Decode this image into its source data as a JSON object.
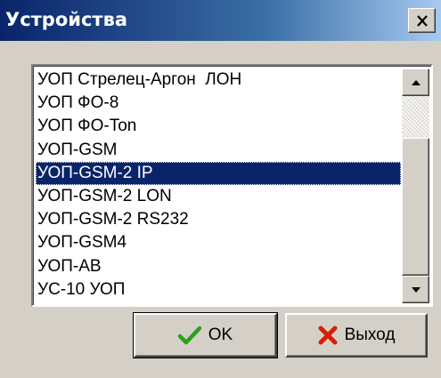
{
  "window": {
    "title": "Устройства",
    "close_symbol": "×"
  },
  "list": {
    "items": [
      {
        "label": "УОП Стрелец-Аргон  ЛОН",
        "selected": false
      },
      {
        "label": "УОП ФО-8",
        "selected": false
      },
      {
        "label": "УОП ФО-Ton",
        "selected": false
      },
      {
        "label": "УОП-GSM",
        "selected": false
      },
      {
        "label": "УОП-GSM-2 IP",
        "selected": true
      },
      {
        "label": "УОП-GSM-2 LON",
        "selected": false
      },
      {
        "label": "УОП-GSM-2 RS232",
        "selected": false
      },
      {
        "label": "УОП-GSM4",
        "selected": false
      },
      {
        "label": "УОП-АВ",
        "selected": false
      },
      {
        "label": "УС-10 УОП",
        "selected": false
      }
    ]
  },
  "buttons": {
    "ok_label": "OK",
    "exit_label": "Выход"
  },
  "icons": {
    "ok": "checkmark-icon",
    "exit": "red-x-icon",
    "scroll_up": "arrow-up-icon",
    "scroll_down": "arrow-down-icon"
  },
  "colors": {
    "title_bar": "#0a246a",
    "selection": "#0a246a",
    "ok_check": "#2e9e1e",
    "exit_x": "#d81e05"
  }
}
